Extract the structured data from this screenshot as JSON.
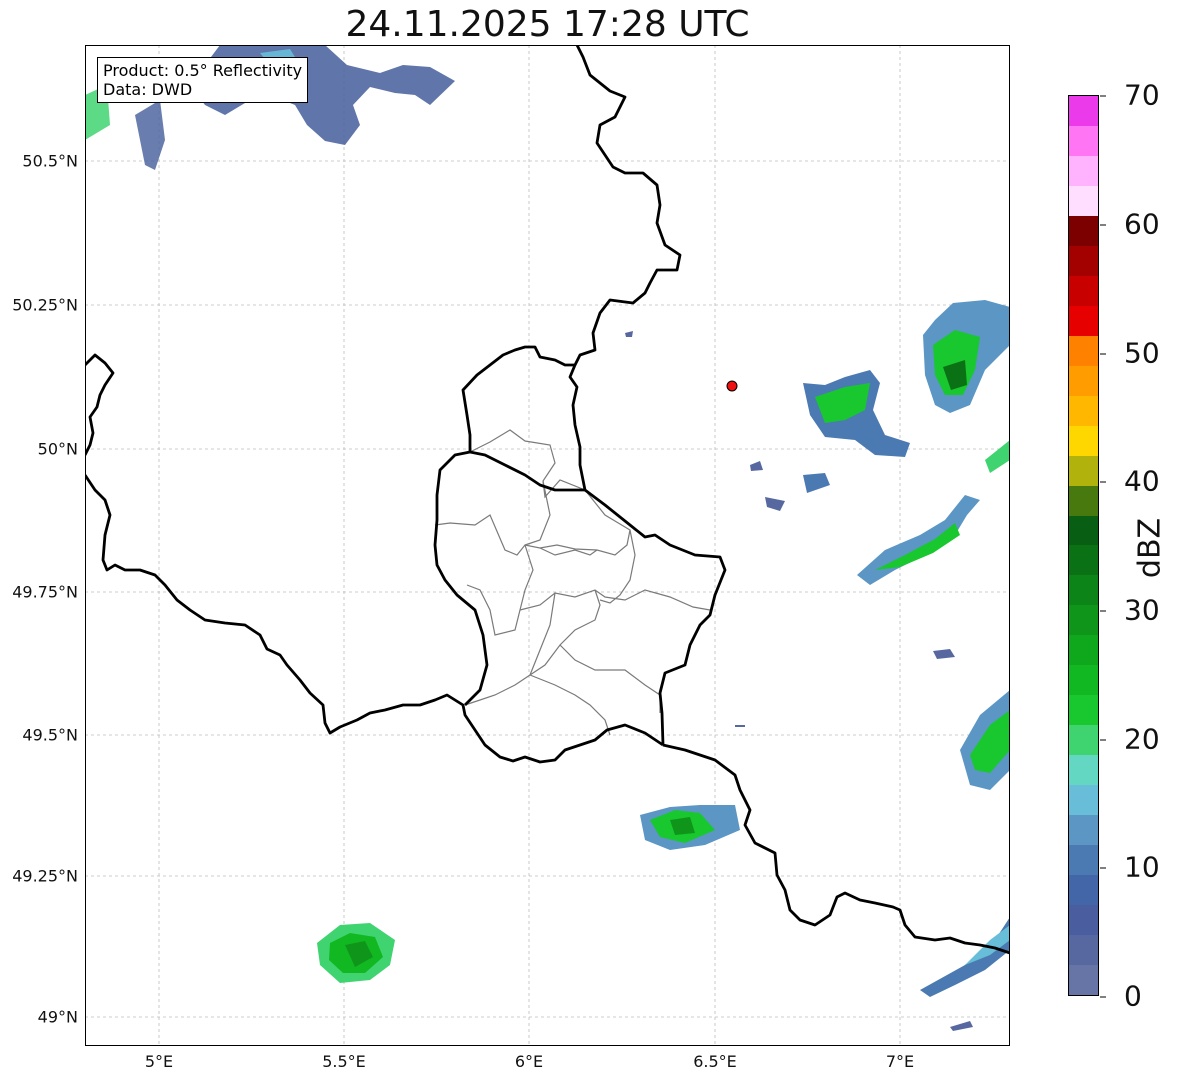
{
  "title": "24.11.2025 17:28 UTC",
  "info_box": {
    "product": "Product: 0.5° Reflectivity",
    "data": "Data: DWD"
  },
  "x_ticks": [
    "5°E",
    "5.5°E",
    "6°E",
    "6.5°E",
    "7°E"
  ],
  "y_ticks": [
    "50.5°N",
    "50.25°N",
    "50°N",
    "49.75°N",
    "49.5°N",
    "49.25°N",
    "49°N"
  ],
  "map_extent": {
    "lon": [
      4.8,
      7.3
    ],
    "lat": [
      48.95,
      50.7
    ]
  },
  "grid": true,
  "radar_site_color": "#ee1111",
  "colorbar": {
    "label": "dBZ",
    "range": [
      0,
      70
    ],
    "ticks": [
      "0",
      "10",
      "20",
      "30",
      "40",
      "50",
      "60",
      "70"
    ],
    "colors": [
      "#6674a6",
      "#5768a0",
      "#4a5e9f",
      "#4366a8",
      "#4b7ab2",
      "#5b96c4",
      "#68bed9",
      "#63d7c2",
      "#3fd470",
      "#18c82e",
      "#12b822",
      "#0fa81c",
      "#0f961a",
      "#0d8418",
      "#0a7215",
      "#085e12",
      "#47790e",
      "#b1b30c",
      "#ffd700",
      "#ffb700",
      "#ff9c00",
      "#ff8100",
      "#e60000",
      "#c80000",
      "#a30000",
      "#7d0000",
      "#ffdeff",
      "#ffb3ff",
      "#ff75f3",
      "#eb3aea"
    ]
  }
}
